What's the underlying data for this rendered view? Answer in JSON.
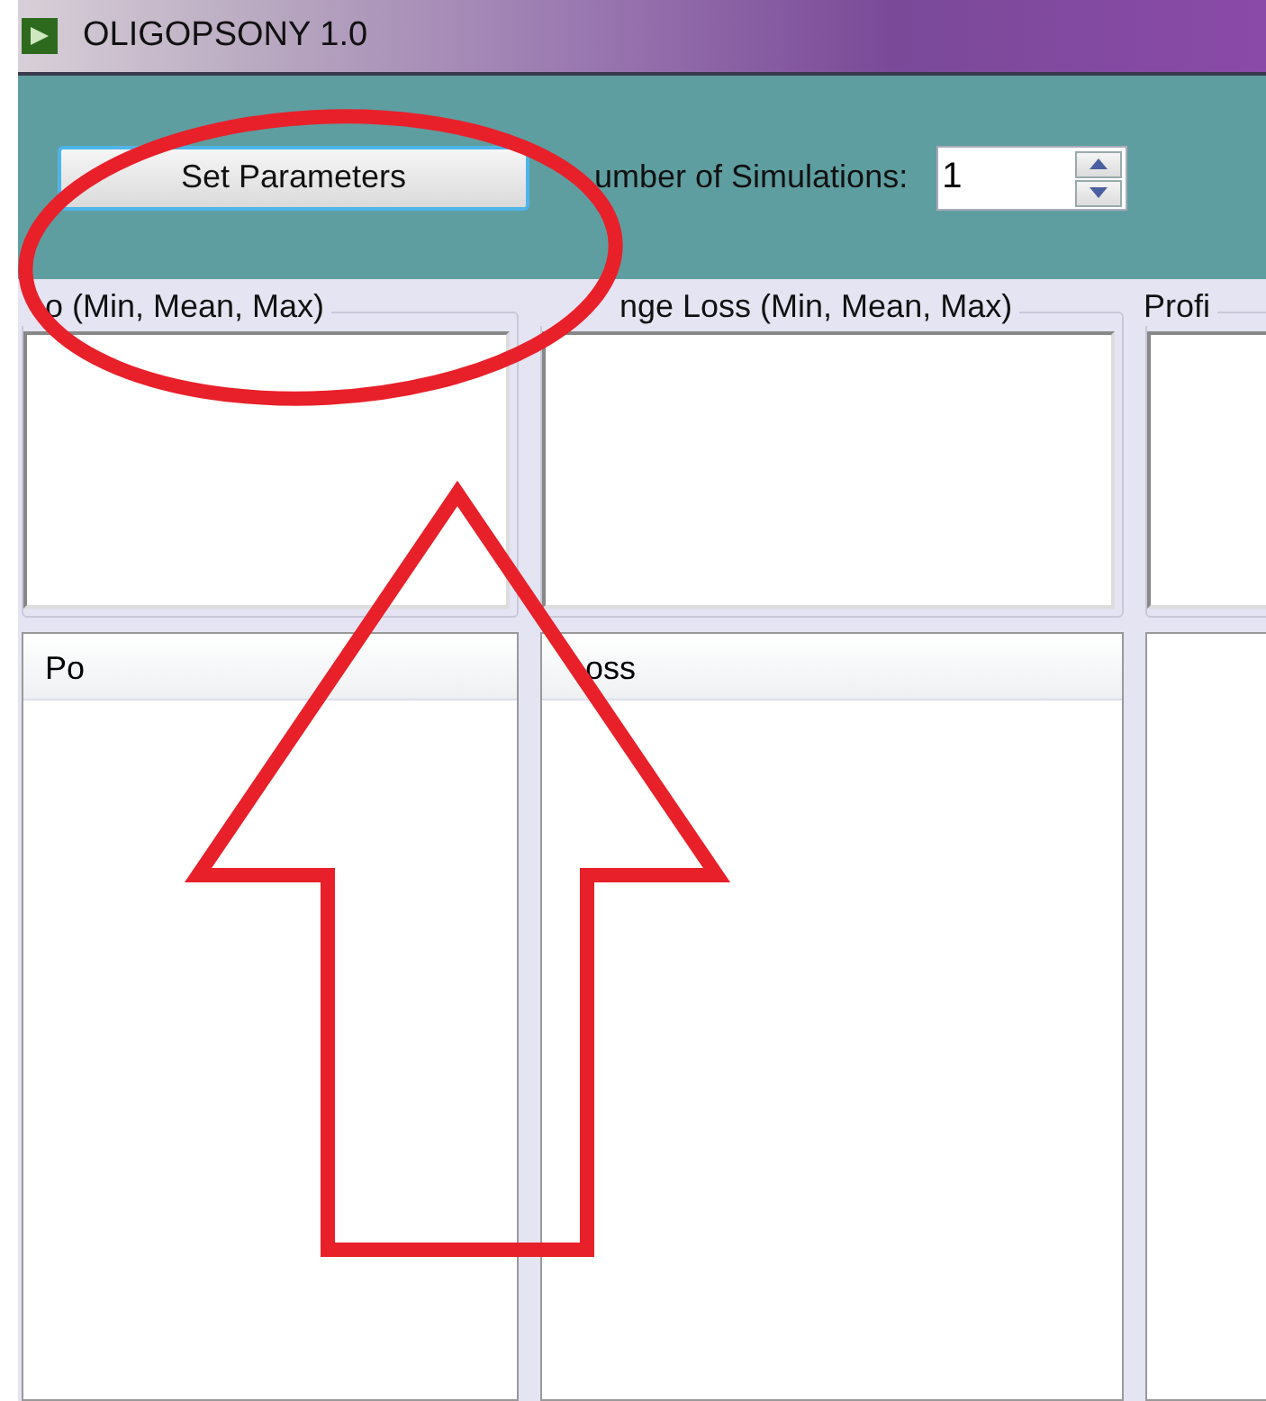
{
  "window": {
    "title": "OLIGOPSONY 1.0"
  },
  "toolbar": {
    "button": "Set Parameters",
    "simulations_label": "umber of Simulations:",
    "simulations_value": "1"
  },
  "panels": [
    {
      "group_label": "o (Min, Mean, Max)",
      "list_header": "Po"
    },
    {
      "group_label": "nge Loss (Min, Mean, Max)",
      "list_header": "oss"
    },
    {
      "group_label": "Profi"
    }
  ],
  "annotations": [
    {
      "kind": "ellipse"
    },
    {
      "kind": "arrow"
    }
  ]
}
